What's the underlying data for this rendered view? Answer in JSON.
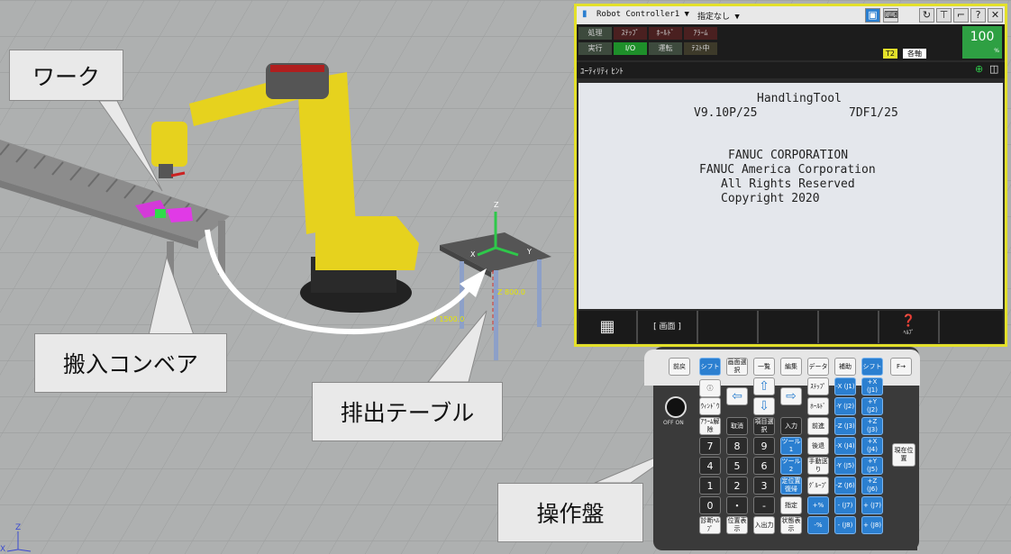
{
  "callouts": {
    "work": "ワーク",
    "conveyor": "搬入コンベア",
    "table": "排出テーブル",
    "panel": "操作盤"
  },
  "scene": {
    "axis_z": "Z",
    "axis_x": "X",
    "axis_y": "Y",
    "dim_z": "Z 800.0",
    "dim_y": "-Y 1500.0",
    "corner_z": "Z",
    "corner_x": "X"
  },
  "pendant": {
    "title": "Robot Controller1 ▼",
    "title_sel": "指定なし ▼",
    "status": [
      "処理",
      "ｽﾃｯﾌﾟ",
      "ﾎｰﾙﾄﾞ",
      "ｱﾗｰﾑ",
      "実行",
      "I/O",
      "運転",
      "ﾃｽﾄ中"
    ],
    "mode_tag": "T2",
    "axis_mode": "各軸",
    "override": "100",
    "override_unit": "%",
    "menu_title": "ﾕｰﾃｨﾘﾃｨ ﾋﾝﾄ",
    "screen_lines": [
      "HandlingTool",
      "V9.10P/25",
      "7DF1/25",
      "FANUC CORPORATION",
      "FANUC America Corporation",
      "All Rights Reserved",
      "Copyright 2020"
    ],
    "fkeys": [
      "[ 画面 ]",
      "ﾍﾙﾌﾟ"
    ],
    "colors": {
      "frame": "#e3e02a",
      "override_bg": "#2ea043",
      "status_green": "#1e8f2a",
      "status_red": "#6a1a1a"
    }
  },
  "keypad": {
    "top": [
      "前戻",
      "シフト",
      "画面選択",
      "一覧",
      "編集",
      "データ",
      "補助",
      "シフト",
      "F→"
    ],
    "left_col": [
      "ｳｨﾝﾄﾞｳ",
      "ｱﾗｰﾑ解除"
    ],
    "row_keys": [
      "取消",
      "項目選択",
      "入力",
      "前進",
      "ｽﾃｯﾌﾟ",
      "ﾎｰﾙﾄﾞ",
      "後退",
      "手動送り",
      "ｸﾞﾙｰﾌﾟ",
      "指定",
      "状態表示",
      "位置表示",
      "入出力",
      "診断ﾍﾙﾌﾟ",
      "ツール1",
      "ツール2",
      "定位置復帰"
    ],
    "digits": [
      "7",
      "8",
      "9",
      "4",
      "5",
      "6",
      "1",
      "2",
      "3",
      "0",
      "・",
      "-"
    ],
    "jog": [
      "-X (J1)",
      "+X (J1)",
      "-Y (J2)",
      "+Y (J2)",
      "-Z (J3)",
      "+Z (J3)",
      "-X (J4)",
      "+X (J4)",
      "-Y (J5)",
      "+Y (J5)",
      "-Z (J6)",
      "+Z (J6)",
      "- (J7)",
      "+ (J7)",
      "- (J8)",
      "+ (J8)"
    ],
    "side": "現在位置",
    "offon": "OFF ON"
  }
}
